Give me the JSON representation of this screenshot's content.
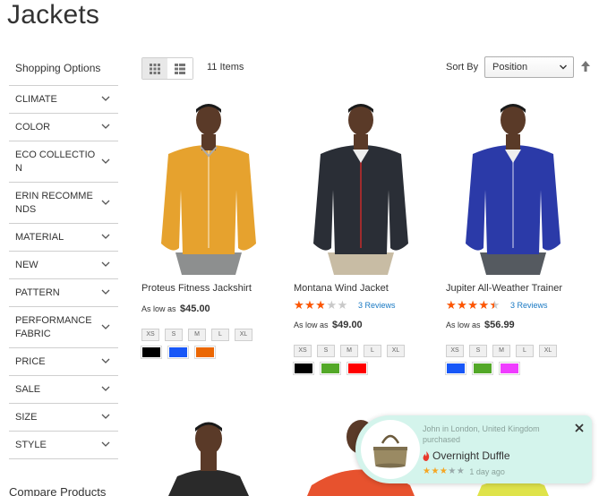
{
  "page": {
    "title": "Jackets"
  },
  "sidebar": {
    "title": "Shopping Options",
    "filters": [
      "CLIMATE",
      "COLOR",
      "ECO COLLECTIO N",
      "ERIN RECOMME NDS",
      "MATERIAL",
      "NEW",
      "PATTERN",
      "PERFORMANCE FABRIC",
      "PRICE",
      "SALE",
      "SIZE",
      "STYLE"
    ],
    "compare_title": "Compare Products"
  },
  "toolbar": {
    "grid_icon": "grid-icon",
    "list_icon": "list-icon",
    "items_count": "11 Items",
    "sort_label": "Sort By",
    "sort_value": "Position",
    "sort_direction_icon": "arrow-up-icon"
  },
  "products": [
    {
      "name": "Proteus Fitness Jackshirt",
      "price_prefix": "As low as",
      "price": "$45.00",
      "rating": null,
      "reviews": "",
      "sizes": [
        "XS",
        "S",
        "M",
        "L",
        "XL"
      ],
      "colors": [
        "#000000",
        "#1857f7",
        "#eb6703"
      ],
      "jacket_color": "#e6a22e"
    },
    {
      "name": "Montana Wind Jacket",
      "price_prefix": "As low as",
      "price": "$49.00",
      "rating": 0.5,
      "reviews": "3 Reviews",
      "sizes": [
        "XS",
        "S",
        "M",
        "L",
        "XL"
      ],
      "colors": [
        "#000000",
        "#53a828",
        "#ff0000"
      ],
      "jacket_color": "#2a2e36"
    },
    {
      "name": "Jupiter All-Weather Trainer",
      "price_prefix": "As low as",
      "price": "$56.99",
      "rating": 0.8,
      "reviews": "3 Reviews",
      "sizes": [
        "XS",
        "S",
        "M",
        "L",
        "XL"
      ],
      "colors": [
        "#1857f7",
        "#53a828",
        "#ef3dff"
      ],
      "jacket_color": "#2b3aa8"
    }
  ],
  "popup": {
    "who": "John in London, United Kingdom purchased",
    "product": "Overnight Duffle",
    "time": "1 day ago",
    "rating": 3,
    "fire_icon": "fire-icon",
    "close_icon": "close-icon"
  }
}
